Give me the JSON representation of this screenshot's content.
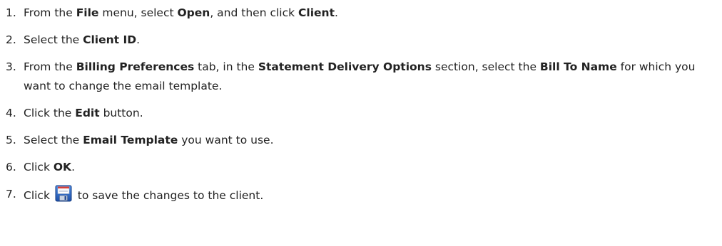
{
  "steps": [
    {
      "num": "1.",
      "p1": "From the ",
      "b1": "File",
      "p2": " menu, select ",
      "b2": "Open",
      "p3": ", and then click ",
      "b3": "Client",
      "p4": "."
    },
    {
      "num": "2.",
      "p1": "Select the ",
      "b1": "Client ID",
      "p2": "."
    },
    {
      "num": "3.",
      "p1": "From the ",
      "b1": "Billing Preferences",
      "p2": " tab, in the ",
      "b2": "Statement Delivery Options",
      "p3": " section, select the ",
      "b3": "Bill To Name",
      "p4": " for which you want to change the email template."
    },
    {
      "num": "4.",
      "p1": "Click the ",
      "b1": "Edit",
      "p2": " button."
    },
    {
      "num": "5.",
      "p1": "Select the ",
      "b1": "Email Template",
      "p2": " you want to use."
    },
    {
      "num": "6.",
      "p1": "Click ",
      "b1": "OK",
      "p2": "."
    },
    {
      "num": "7.",
      "p1": "Click ",
      "icon": "save-icon",
      "p2": " to save the changes to the client."
    }
  ],
  "colors": {
    "text": "#222222",
    "icon_blue": "#1f5fbf",
    "icon_red": "#d6403a"
  }
}
